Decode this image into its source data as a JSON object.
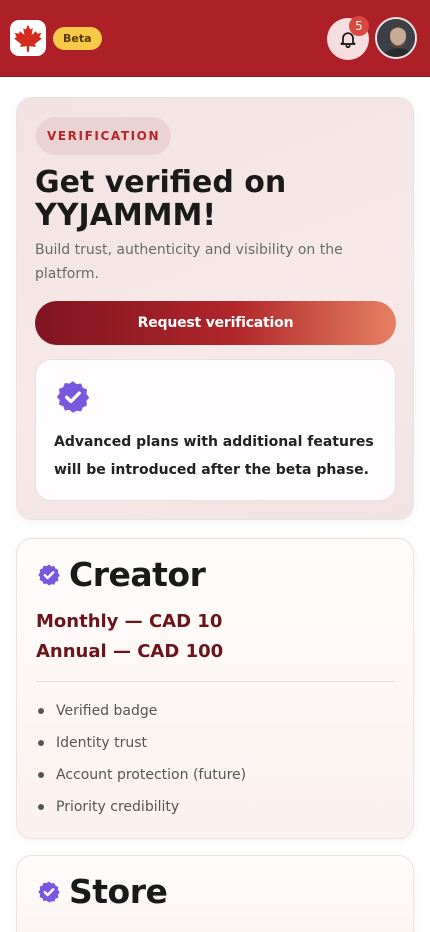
{
  "header": {
    "logo_icon": "maple-leaf-icon",
    "beta_label": "Beta",
    "notifications": {
      "icon": "bell-icon",
      "count": "5"
    },
    "avatar_icon": "user-avatar"
  },
  "verification": {
    "pill": "VERIFICATION",
    "title": "Get verified on YYJAMMM!",
    "subtitle": "Build trust, authenticity and visibility on the platform.",
    "cta": "Request verification",
    "info_icon": "verified-badge-icon",
    "info_text": "Advanced plans with additional features will be introduced after the beta phase."
  },
  "plans": [
    {
      "name": "Creator",
      "monthly": "Monthly — CAD 10",
      "annual": "Annual — CAD 100",
      "features": [
        "Verified badge",
        "Identity trust",
        "Account protection (future)",
        "Priority credibility"
      ]
    },
    {
      "name": "Store"
    }
  ],
  "colors": {
    "header": "#ad2027",
    "accent_purple": "#7b57e0",
    "price_text": "#6b141b",
    "beta": "#f7c948"
  }
}
